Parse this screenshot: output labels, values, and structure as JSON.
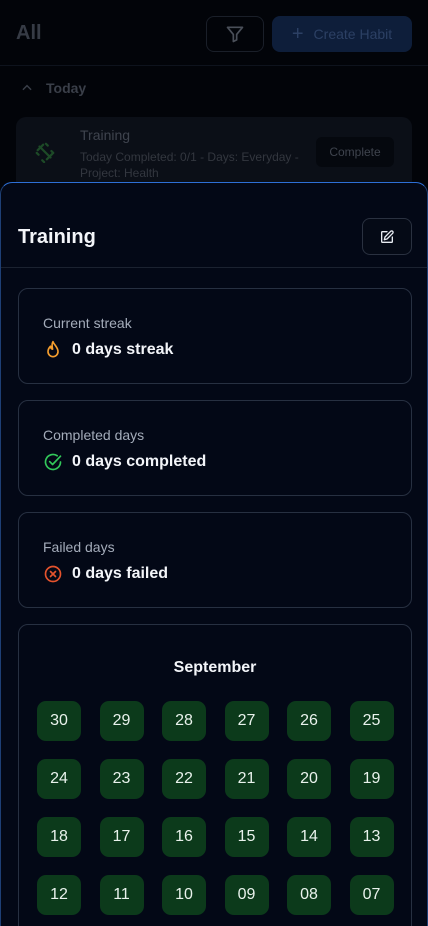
{
  "background": {
    "title": "All",
    "filter_icon": "filter-icon",
    "create_label": "Create Habit",
    "section_label": "Today",
    "habit": {
      "name": "Training",
      "meta_line1": "Today Completed: 0/1 - Days: Everyday -",
      "meta_line2": "Project: Health",
      "complete_label": "Complete"
    }
  },
  "sheet": {
    "title": "Training",
    "edit_icon": "edit-icon",
    "stats": [
      {
        "label": "Current streak",
        "value": "0 days streak",
        "icon": "flame-icon",
        "color": "#f59e2e"
      },
      {
        "label": "Completed days",
        "value": "0 days completed",
        "icon": "check-circle-icon",
        "color": "#32c85a"
      },
      {
        "label": "Failed days",
        "value": "0 days failed",
        "icon": "x-circle-icon",
        "color": "#e5532d"
      }
    ],
    "calendar": {
      "month": "September",
      "days": [
        "30",
        "29",
        "28",
        "27",
        "26",
        "25",
        "24",
        "23",
        "22",
        "21",
        "20",
        "19",
        "18",
        "17",
        "16",
        "15",
        "14",
        "13",
        "12",
        "11",
        "10",
        "09",
        "08",
        "07"
      ]
    }
  },
  "colors": {
    "accent": "#2d6fd6",
    "day_bg": "#0c3a1b",
    "sheet_bg": "#030816"
  }
}
